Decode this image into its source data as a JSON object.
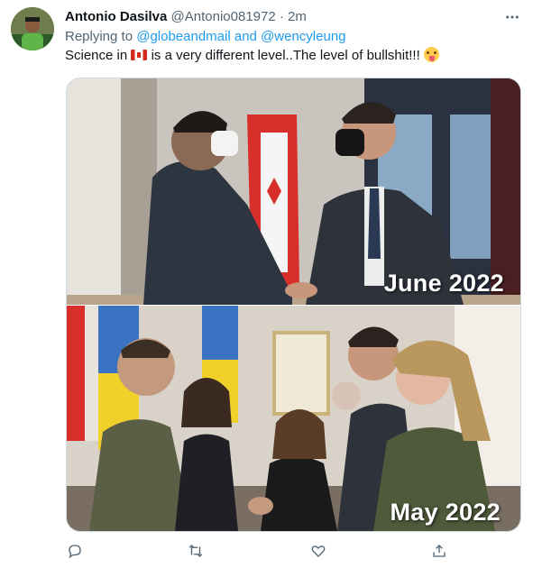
{
  "tweet": {
    "author_name": "Antonio Dasilva",
    "author_handle": "@Antonio081972",
    "separator": "·",
    "timestamp": "2m",
    "reply_prefix": "Replying to",
    "reply_handle_1": "@globeandmail",
    "reply_conjunction": "and",
    "reply_handle_2": "@wencyleung",
    "text_before_flag": "Science in",
    "text_after_flag": "is a very different level..The level of bullshit!!!",
    "flag_icon": "canada-flag-emoji",
    "emoji_icon": "zany-face-emoji"
  },
  "media": {
    "top_caption": "June 2022",
    "bottom_caption": "May 2022"
  },
  "actions": [
    {
      "name": "reply-button",
      "icon": "speech-bubble-icon"
    },
    {
      "name": "retweet-button",
      "icon": "retweet-icon"
    },
    {
      "name": "like-button",
      "icon": "heart-icon"
    },
    {
      "name": "share-button",
      "icon": "share-icon"
    }
  ],
  "colors": {
    "link": "#1d9bf0",
    "secondary_text": "#536471",
    "primary_text": "#0f1419",
    "media_border": "#cfd9de"
  }
}
